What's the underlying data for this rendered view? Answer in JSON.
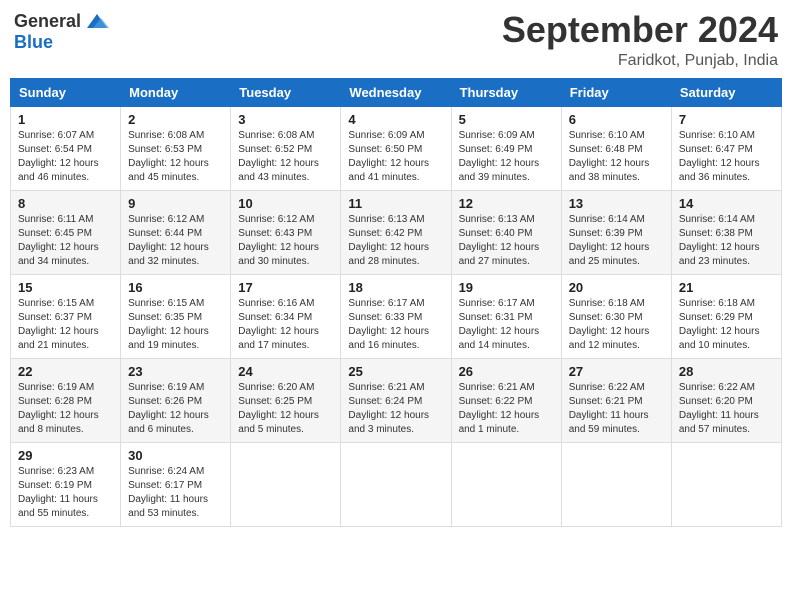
{
  "header": {
    "logo": {
      "general": "General",
      "blue": "Blue"
    },
    "title": "September 2024",
    "location": "Faridkot, Punjab, India"
  },
  "calendar": {
    "days_of_week": [
      "Sunday",
      "Monday",
      "Tuesday",
      "Wednesday",
      "Thursday",
      "Friday",
      "Saturday"
    ],
    "weeks": [
      [
        {
          "day": "1",
          "info": "Sunrise: 6:07 AM\nSunset: 6:54 PM\nDaylight: 12 hours\nand 46 minutes."
        },
        {
          "day": "2",
          "info": "Sunrise: 6:08 AM\nSunset: 6:53 PM\nDaylight: 12 hours\nand 45 minutes."
        },
        {
          "day": "3",
          "info": "Sunrise: 6:08 AM\nSunset: 6:52 PM\nDaylight: 12 hours\nand 43 minutes."
        },
        {
          "day": "4",
          "info": "Sunrise: 6:09 AM\nSunset: 6:50 PM\nDaylight: 12 hours\nand 41 minutes."
        },
        {
          "day": "5",
          "info": "Sunrise: 6:09 AM\nSunset: 6:49 PM\nDaylight: 12 hours\nand 39 minutes."
        },
        {
          "day": "6",
          "info": "Sunrise: 6:10 AM\nSunset: 6:48 PM\nDaylight: 12 hours\nand 38 minutes."
        },
        {
          "day": "7",
          "info": "Sunrise: 6:10 AM\nSunset: 6:47 PM\nDaylight: 12 hours\nand 36 minutes."
        }
      ],
      [
        {
          "day": "8",
          "info": "Sunrise: 6:11 AM\nSunset: 6:45 PM\nDaylight: 12 hours\nand 34 minutes."
        },
        {
          "day": "9",
          "info": "Sunrise: 6:12 AM\nSunset: 6:44 PM\nDaylight: 12 hours\nand 32 minutes."
        },
        {
          "day": "10",
          "info": "Sunrise: 6:12 AM\nSunset: 6:43 PM\nDaylight: 12 hours\nand 30 minutes."
        },
        {
          "day": "11",
          "info": "Sunrise: 6:13 AM\nSunset: 6:42 PM\nDaylight: 12 hours\nand 28 minutes."
        },
        {
          "day": "12",
          "info": "Sunrise: 6:13 AM\nSunset: 6:40 PM\nDaylight: 12 hours\nand 27 minutes."
        },
        {
          "day": "13",
          "info": "Sunrise: 6:14 AM\nSunset: 6:39 PM\nDaylight: 12 hours\nand 25 minutes."
        },
        {
          "day": "14",
          "info": "Sunrise: 6:14 AM\nSunset: 6:38 PM\nDaylight: 12 hours\nand 23 minutes."
        }
      ],
      [
        {
          "day": "15",
          "info": "Sunrise: 6:15 AM\nSunset: 6:37 PM\nDaylight: 12 hours\nand 21 minutes."
        },
        {
          "day": "16",
          "info": "Sunrise: 6:15 AM\nSunset: 6:35 PM\nDaylight: 12 hours\nand 19 minutes."
        },
        {
          "day": "17",
          "info": "Sunrise: 6:16 AM\nSunset: 6:34 PM\nDaylight: 12 hours\nand 17 minutes."
        },
        {
          "day": "18",
          "info": "Sunrise: 6:17 AM\nSunset: 6:33 PM\nDaylight: 12 hours\nand 16 minutes."
        },
        {
          "day": "19",
          "info": "Sunrise: 6:17 AM\nSunset: 6:31 PM\nDaylight: 12 hours\nand 14 minutes."
        },
        {
          "day": "20",
          "info": "Sunrise: 6:18 AM\nSunset: 6:30 PM\nDaylight: 12 hours\nand 12 minutes."
        },
        {
          "day": "21",
          "info": "Sunrise: 6:18 AM\nSunset: 6:29 PM\nDaylight: 12 hours\nand 10 minutes."
        }
      ],
      [
        {
          "day": "22",
          "info": "Sunrise: 6:19 AM\nSunset: 6:28 PM\nDaylight: 12 hours\nand 8 minutes."
        },
        {
          "day": "23",
          "info": "Sunrise: 6:19 AM\nSunset: 6:26 PM\nDaylight: 12 hours\nand 6 minutes."
        },
        {
          "day": "24",
          "info": "Sunrise: 6:20 AM\nSunset: 6:25 PM\nDaylight: 12 hours\nand 5 minutes."
        },
        {
          "day": "25",
          "info": "Sunrise: 6:21 AM\nSunset: 6:24 PM\nDaylight: 12 hours\nand 3 minutes."
        },
        {
          "day": "26",
          "info": "Sunrise: 6:21 AM\nSunset: 6:22 PM\nDaylight: 12 hours\nand 1 minute."
        },
        {
          "day": "27",
          "info": "Sunrise: 6:22 AM\nSunset: 6:21 PM\nDaylight: 11 hours\nand 59 minutes."
        },
        {
          "day": "28",
          "info": "Sunrise: 6:22 AM\nSunset: 6:20 PM\nDaylight: 11 hours\nand 57 minutes."
        }
      ],
      [
        {
          "day": "29",
          "info": "Sunrise: 6:23 AM\nSunset: 6:19 PM\nDaylight: 11 hours\nand 55 minutes."
        },
        {
          "day": "30",
          "info": "Sunrise: 6:24 AM\nSunset: 6:17 PM\nDaylight: 11 hours\nand 53 minutes."
        },
        {
          "day": "",
          "info": ""
        },
        {
          "day": "",
          "info": ""
        },
        {
          "day": "",
          "info": ""
        },
        {
          "day": "",
          "info": ""
        },
        {
          "day": "",
          "info": ""
        }
      ]
    ]
  }
}
